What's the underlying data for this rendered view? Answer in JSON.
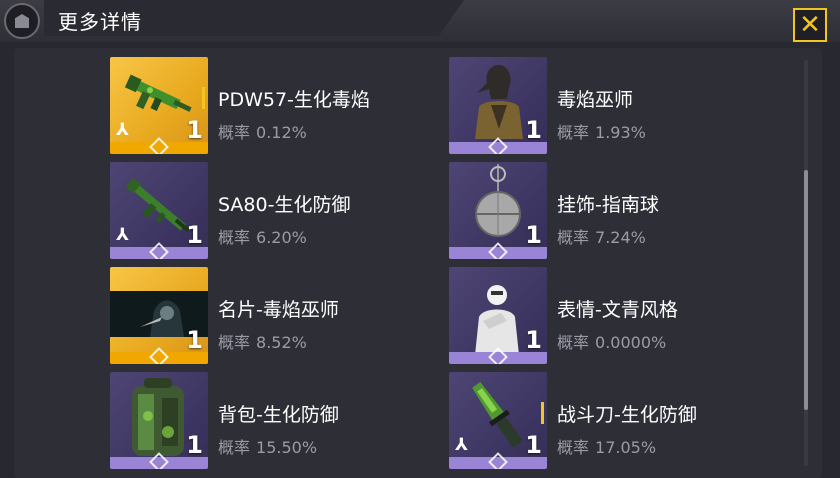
{
  "header": {
    "title": "更多详情"
  },
  "items": [
    {
      "name": "PDW57-生化毒焰",
      "prob_label": "概率",
      "prob": "0.12%",
      "qty": "1",
      "rarity": "gold",
      "icon": "smg-icon",
      "weapon_mark": "⅄",
      "has_bar": true
    },
    {
      "name": "毒焰巫师",
      "prob_label": "概率",
      "prob": "1.93%",
      "qty": "1",
      "rarity": "purple",
      "icon": "character-icon",
      "weapon_mark": "",
      "has_bar": false
    },
    {
      "name": "SA80-生化防御",
      "prob_label": "概率",
      "prob": "6.20%",
      "qty": "1",
      "rarity": "purple",
      "icon": "rifle-icon",
      "weapon_mark": "⅄",
      "has_bar": false
    },
    {
      "name": "挂饰-指南球",
      "prob_label": "概率",
      "prob": "7.24%",
      "qty": "1",
      "rarity": "purple",
      "icon": "charm-icon",
      "weapon_mark": "",
      "has_bar": false
    },
    {
      "name": "名片-毒焰巫师",
      "prob_label": "概率",
      "prob": "8.52%",
      "qty": "1",
      "rarity": "gold",
      "icon": "calling-card-icon",
      "weapon_mark": "",
      "has_bar": false
    },
    {
      "name": "表情-文青风格",
      "prob_label": "概率",
      "prob": "0.0000%",
      "qty": "1",
      "rarity": "purple",
      "icon": "emote-icon",
      "weapon_mark": "",
      "has_bar": false
    },
    {
      "name": "背包-生化防御",
      "prob_label": "概率",
      "prob": "15.50%",
      "qty": "1",
      "rarity": "purple",
      "icon": "backpack-icon",
      "weapon_mark": "",
      "has_bar": false
    },
    {
      "name": "战斗刀-生化防御",
      "prob_label": "概率",
      "prob": "17.05%",
      "qty": "1",
      "rarity": "purple",
      "icon": "knife-icon",
      "weapon_mark": "⅄",
      "has_bar": true
    }
  ],
  "colors": {
    "accent": "#f3c51f",
    "gold": "#f0a800",
    "purple": "#9a84d6"
  }
}
